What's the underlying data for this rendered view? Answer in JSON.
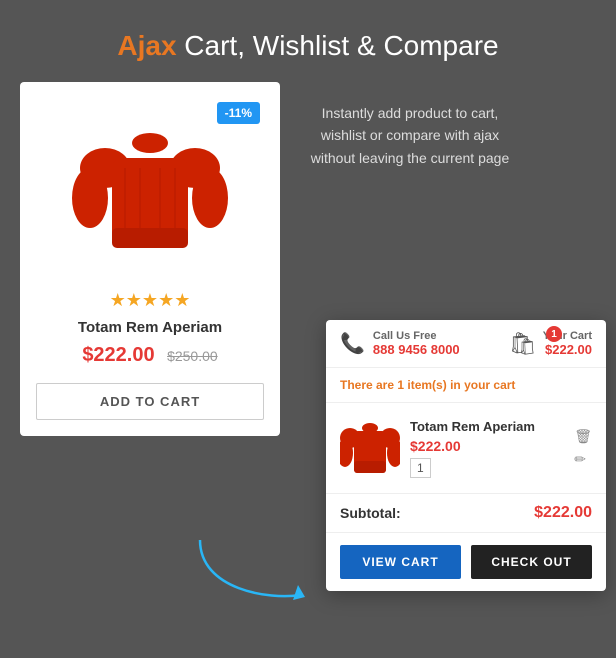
{
  "header": {
    "title_ajax": "Ajax",
    "title_rest": " Cart, Wishlist & Compare"
  },
  "description": {
    "text": "Instantly add product to cart, wishlist or compare with ajax without leaving the current page"
  },
  "product": {
    "discount_badge": "-11%",
    "name": "Totam Rem Aperiam",
    "price_current": "$222.00",
    "price_original": "$250.00",
    "stars": "★★★★★",
    "add_to_cart_label": "ADD TO CART"
  },
  "cart_popup": {
    "phone_label": "Call Us Free",
    "phone_number": "888 9456 8000",
    "cart_label": "Your Cart",
    "cart_amount": "$222.00",
    "cart_badge": "1",
    "summary_text_pre": "There are ",
    "summary_count": "1 item(s)",
    "summary_text_post": " in your cart",
    "item": {
      "name": "Totam Rem Aperiam",
      "price": "$222.00",
      "qty": "1"
    },
    "subtotal_label": "Subtotal:",
    "subtotal_amount": "$222.00",
    "view_cart_label": "VIEW CART",
    "checkout_label": "CHECK OUT"
  }
}
